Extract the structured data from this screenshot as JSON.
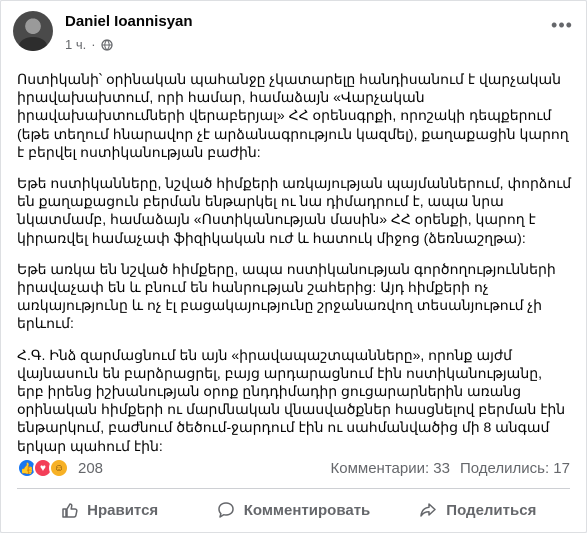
{
  "post": {
    "author": "Daniel Ioannisyan",
    "time": "1 ч.",
    "separator": "·",
    "visibility_icon": "globe-icon",
    "more_icon": "more-horizontal-icon",
    "more_label": "•••",
    "paragraphs": [
      "Ոստիկանի՝ օրինական պահանջը չկատարելը հանդիսանում է վարչական իրավախախտում, որի համար, համաձայն «Վարչական իրավախախտումների վերաբերյալ» ՀՀ օրենսգրքի, որոշակի դեպքերում (եթե տեղում հնարավոր չէ արձանագրություն կազմել), քաղաքացին կարող է բերվել ոստիկանության բաժին:",
      "Եթե ոստիկանները, նշված հիմքերի առկայության պայմաններում, փորձում են քաղաքացուն բերման ենթարկել ու նա դիմադրում է, ապա նրա նկատմամբ, համաձայն «Ոստիկանության մասին» ՀՀ օրենքի, կարող է կիրառվել համաչափ ֆիզիկական ուժ և հատուկ միջոց (ձեռնաշղթա):",
      "Եթե առկա են նշված հիմքերը, ապա ոստիկանության գործողությունների իրավաչափ են և բնում են հանրության շահերից: Այդ հիմքերի ոչ առկայությունը և ոչ էլ բացակայությունը շրջանառվող տեսանյութում չի երևում:",
      "Հ.Գ. Ինձ զարմացնում են այն «իրավապաշտպանները», որոնք այժմ վայնասուն են բարձրացրել, բայց արդարացնում էին ոստիկանությանը, երբ իրենց իշխանության օրոք ընդդիմադիր ցուցարարներին առանց օրինական հիմքերի ու մարմնական վնասվածքներ հասցնելով բերման էին ենթարկում, բաժնում ծեծում-ջարդում էին ու սահմանվածից մի 8 անգամ երկար պահում էին:"
    ]
  },
  "stats": {
    "reaction_count": "208",
    "comments_text": "Комментарии: 33",
    "shares_text": "Поделились: 17",
    "reaction_icons": [
      "like-reaction-icon",
      "love-reaction-icon",
      "haha-reaction-icon"
    ]
  },
  "actions": {
    "like": {
      "label": "Нравится",
      "icon": "thumbs-up-icon"
    },
    "comment": {
      "label": "Комментировать",
      "icon": "comment-icon"
    },
    "share": {
      "label": "Поделиться",
      "icon": "share-icon"
    }
  },
  "colors": {
    "background": "#f0f2f5",
    "card": "#ffffff",
    "text": "#050505",
    "muted": "#65676b",
    "like_blue": "#1877f2",
    "love_red": "#f33e58",
    "haha_yellow": "#f7b125"
  }
}
